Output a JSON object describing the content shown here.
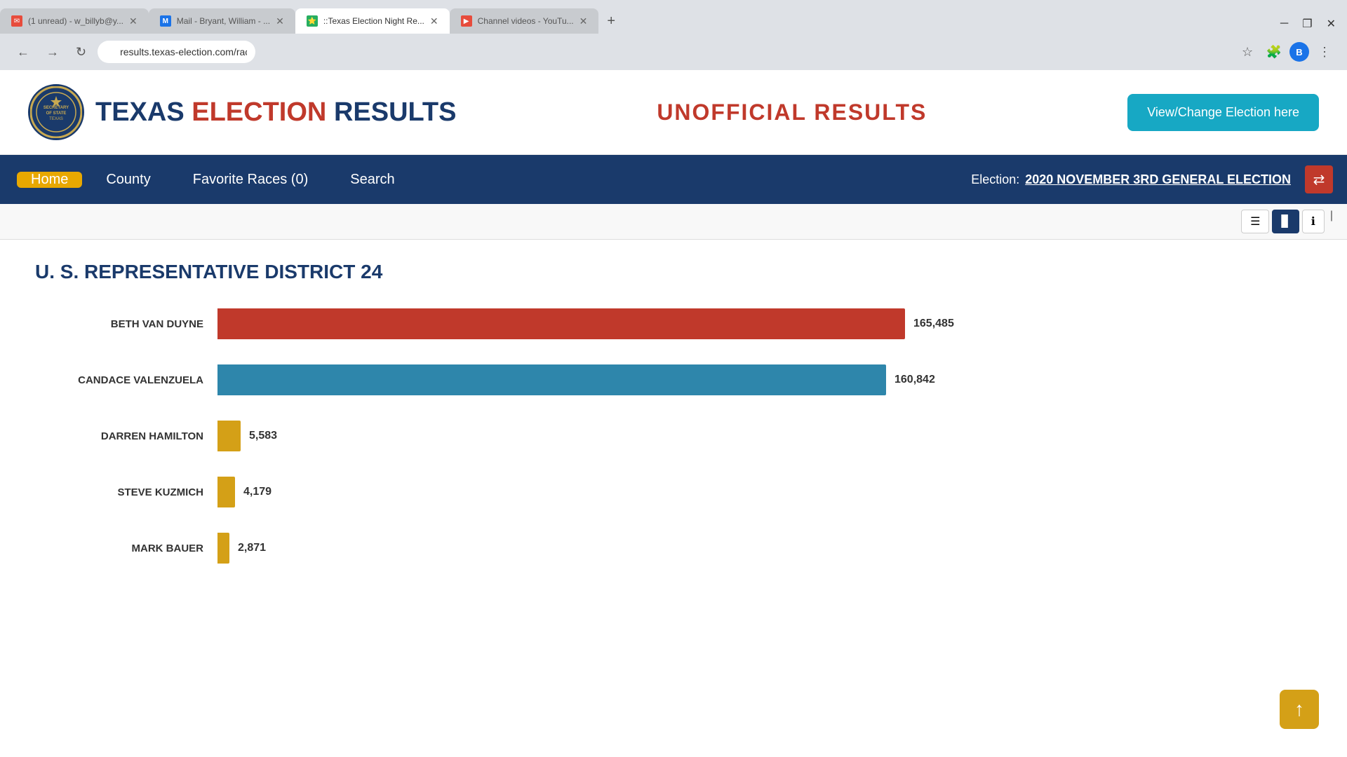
{
  "browser": {
    "tabs": [
      {
        "id": "tab1",
        "favicon_color": "#e74c3c",
        "favicon_text": "✉",
        "title": "(1 unread) - w_billyb@y...",
        "active": false
      },
      {
        "id": "tab2",
        "favicon_color": "#1a73e8",
        "favicon_text": "M",
        "title": "Mail - Bryant, William - ...",
        "active": false
      },
      {
        "id": "tab3",
        "favicon_color": "#27ae60",
        "favicon_text": "⭐",
        "title": "::Texas Election Night Re...",
        "active": true
      },
      {
        "id": "tab4",
        "favicon_color": "#e74c3c",
        "favicon_text": "▶",
        "title": "Channel videos - YouTu...",
        "active": false
      }
    ],
    "address": "results.texas-election.com/races",
    "profile_initial": "B"
  },
  "site": {
    "title_part1": "TEXAS ",
    "title_part2": "ELECTION ",
    "title_part3": "RESULTS",
    "unofficial_label": "UNOFFICIAL  RESULTS",
    "view_change_btn": "View/Change Election here",
    "seal_text": "SECRETARY OF STATE"
  },
  "nav": {
    "home_label": "Home",
    "county_label": "County",
    "favorite_races_label": "Favorite Races (0)",
    "search_label": "Search",
    "election_prefix": "Election:",
    "election_name": "2020 NOVEMBER 3RD GENERAL ELECTION"
  },
  "race": {
    "title": "U. S. REPRESENTATIVE DISTRICT 24",
    "candidates": [
      {
        "name": "BETH VAN DUYNE",
        "votes": 165485,
        "votes_display": "165,485",
        "color": "red",
        "bar_pct": 97
      },
      {
        "name": "CANDACE VALENZUELA",
        "votes": 160842,
        "votes_display": "160,842",
        "color": "blue",
        "bar_pct": 94
      },
      {
        "name": "DARREN HAMILTON",
        "votes": 5583,
        "votes_display": "5,583",
        "color": "gold",
        "bar_pct": 3
      },
      {
        "name": "STEVE KUZMICH",
        "votes": 4179,
        "votes_display": "4,179",
        "color": "gold",
        "bar_pct": 2.4
      },
      {
        "name": "MARK BAUER",
        "votes": 2871,
        "votes_display": "2,871",
        "color": "gold",
        "bar_pct": 1.6
      }
    ]
  }
}
